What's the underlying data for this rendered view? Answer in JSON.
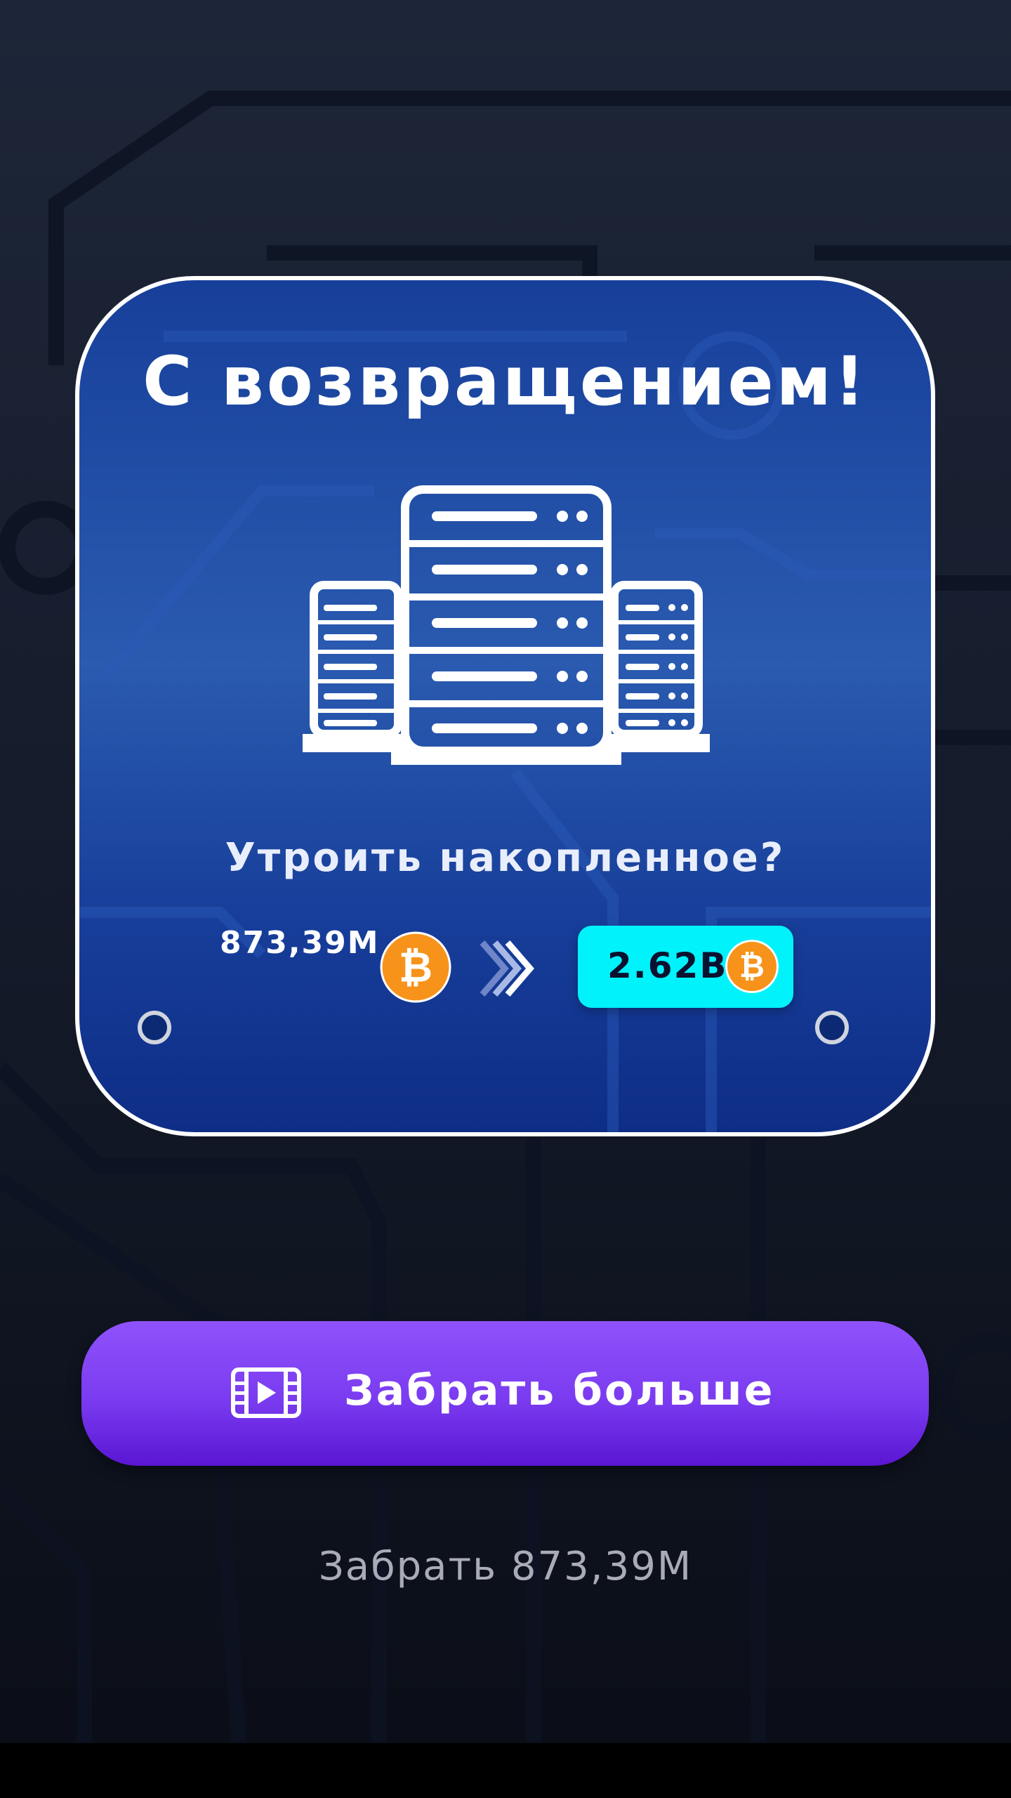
{
  "dialog": {
    "title": "С возвращением!",
    "question": "Утроить накопленное?",
    "current_amount": "873,39M",
    "tripled_amount": "2.62B"
  },
  "actions": {
    "claim_more_label": "Забрать больше",
    "claim_base_label": "Забрать 873,39M"
  },
  "icons": {
    "server": "server-rack-icon",
    "coin": "bitcoin-icon",
    "arrows": "chevrons-right-icon",
    "video": "video-ad-icon",
    "screw": "screw-icon"
  },
  "colors": {
    "card_blue": "#1a46a0",
    "highlight_cyan": "#00f2fb",
    "button_purple": "#7a3bf0",
    "bitcoin_orange": "#f7931a"
  }
}
